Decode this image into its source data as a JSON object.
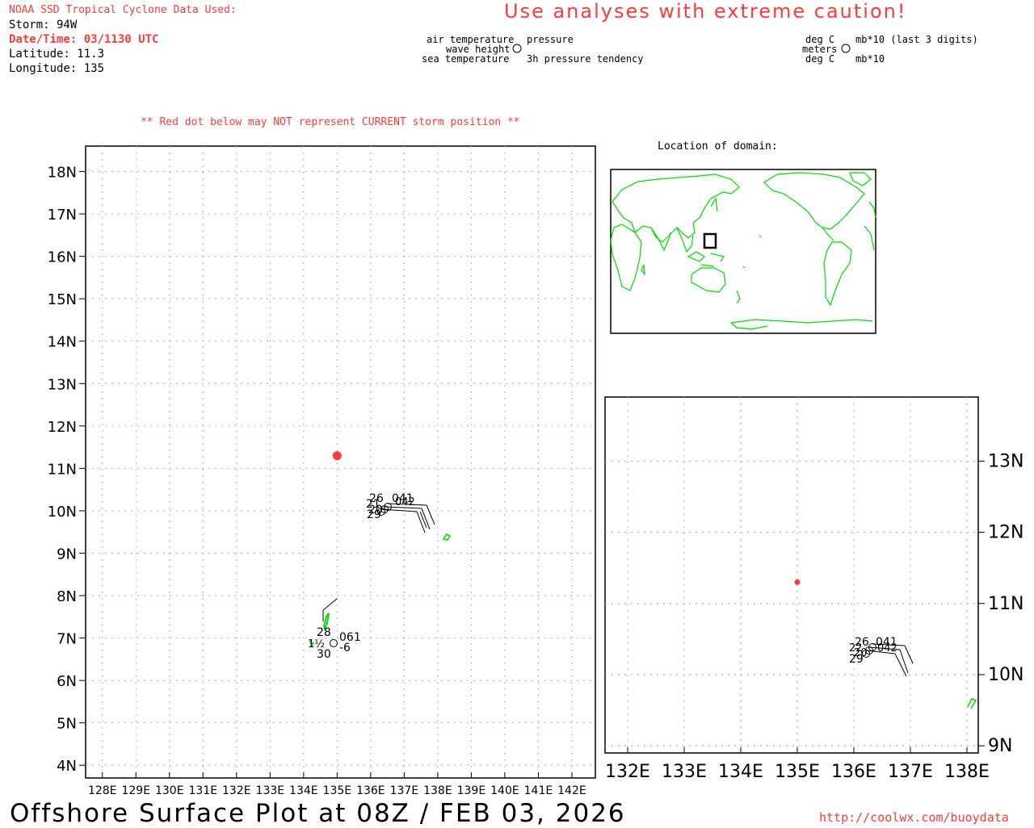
{
  "header": {
    "source": "NOAA SSD Tropical Cyclone Data Used:",
    "storm": "Storm: 94W",
    "datetime": "Date/Time: 03/1130 UTC",
    "latitude": "Latitude: 11.3",
    "longitude": "Longitude: 135",
    "caution": "Use analyses with extreme caution!",
    "red_dot_note": "** Red dot below may NOT represent CURRENT storm position **"
  },
  "legend_left": {
    "air_temperature": "air temperature",
    "wave_height": "wave height",
    "sea_temperature": "sea temperature",
    "pressure": "pressure",
    "pressure_tendency": "3h pressure tendency"
  },
  "legend_right": {
    "deg_c_top": "deg C",
    "meters": "meters",
    "deg_c_bottom": "deg C",
    "mb_last3": "mb*10 (last 3 digits)",
    "mb10": "mb*10"
  },
  "inset": {
    "title": "Location of domain:"
  },
  "main_map": {
    "lat_labels": [
      "18N",
      "17N",
      "16N",
      "15N",
      "14N",
      "13N",
      "12N",
      "11N",
      "10N",
      "9N",
      "8N",
      "7N",
      "6N",
      "5N",
      "4N"
    ],
    "lon_labels": [
      "128E",
      "129E",
      "130E",
      "131E",
      "132E",
      "133E",
      "134E",
      "135E",
      "136E",
      "137E",
      "138E",
      "139E",
      "140E",
      "141E",
      "142E"
    ],
    "lat_range": [
      3.7,
      18.6
    ],
    "lon_range": [
      127.5,
      142.7
    ],
    "storm_position": {
      "lat": 11.3,
      "lon": 135.0
    },
    "obs_cluster": {
      "t1": "26",
      "p1": "041",
      "t2": "21",
      "p2": "042",
      "t3": "20",
      "t4": "29"
    },
    "obs_single": {
      "air_temp": "28",
      "wave": "1½",
      "pressure": "061",
      "tendency": "-6",
      "sea_temp": "30"
    }
  },
  "zoom_map": {
    "lat_labels": [
      "13N",
      "12N",
      "11N",
      "10N",
      "9N"
    ],
    "lon_labels": [
      "132E",
      "133E",
      "134E",
      "135E",
      "136E",
      "137E",
      "138E"
    ],
    "lat_range": [
      8.9,
      13.9
    ],
    "lon_range": [
      131.6,
      138.2
    ],
    "storm_position": {
      "lat": 11.3,
      "lon": 135.0
    },
    "obs_cluster": {
      "t1": "26",
      "p1": "041",
      "t2": "22",
      "p2": "042",
      "t3": "20",
      "t4": "29"
    }
  },
  "footer": {
    "title": "Offshore Surface Plot at 08Z / FEB 03, 2026",
    "url": "http://coolwx.com/buoydata"
  },
  "colors": {
    "accent_red": "#ff3b3b",
    "land_green": "#00dd00",
    "grid": "#b0b0b0"
  }
}
